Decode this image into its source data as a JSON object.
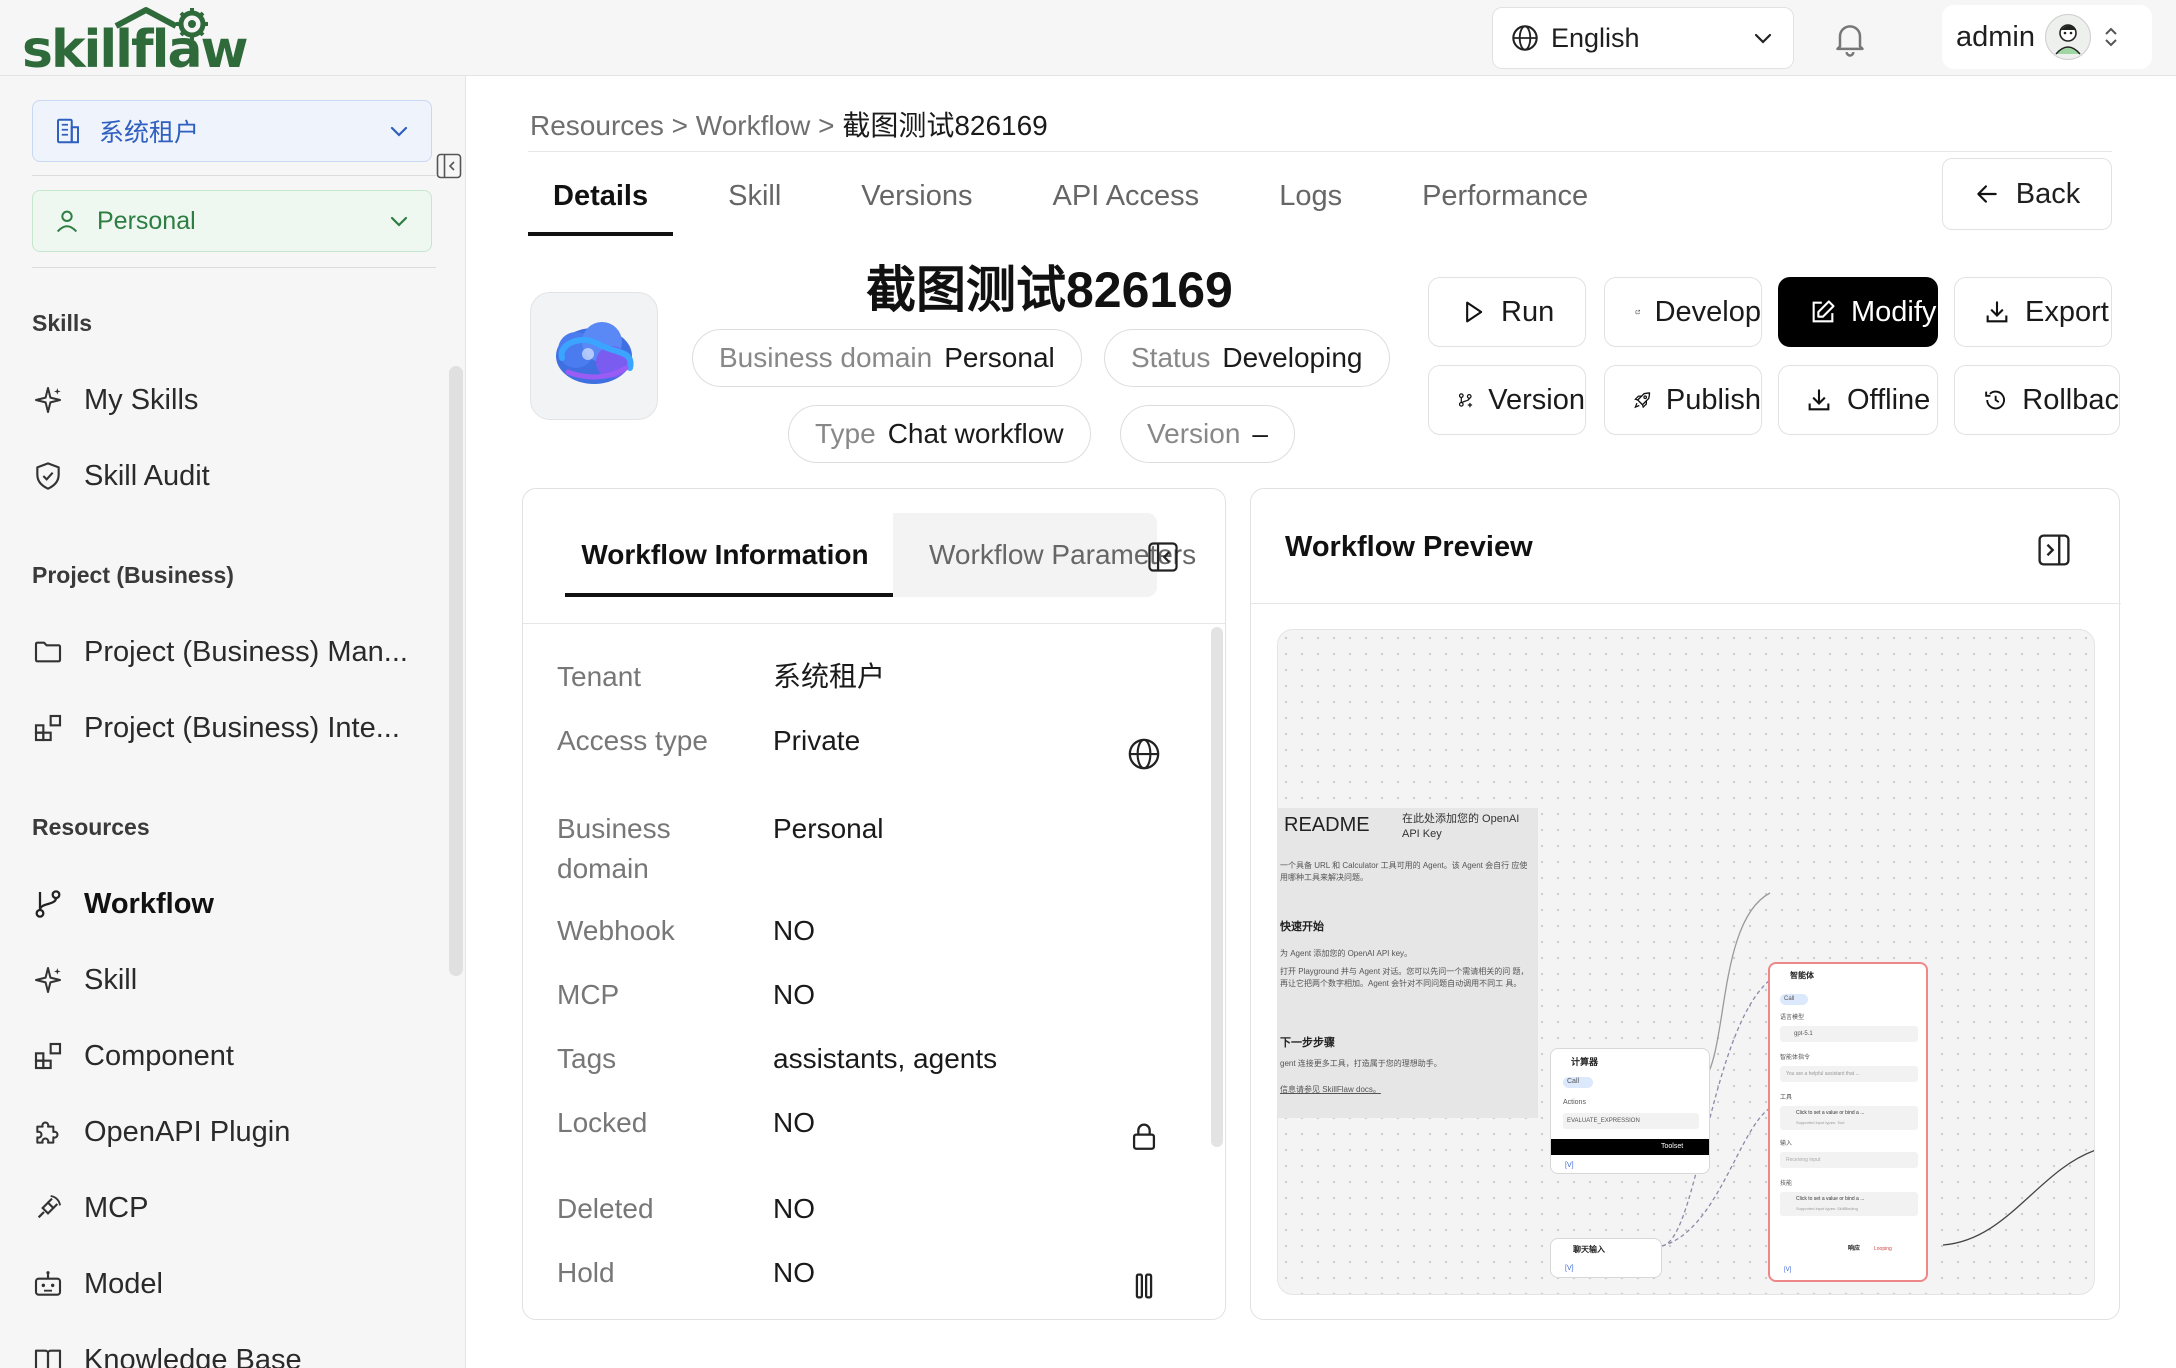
{
  "header": {
    "logo_text": "skillflaw",
    "language": "English",
    "user_name": "admin"
  },
  "sidebar": {
    "tenant_select": "系统租户",
    "scope_select": "Personal",
    "sections": {
      "skills": "Skills",
      "project": "Project (Business)",
      "resources": "Resources"
    },
    "skills_items": [
      "My Skills",
      "Skill Audit"
    ],
    "project_items": [
      "Project (Business) Man...",
      "Project (Business) Inte..."
    ],
    "resource_items": [
      "Workflow",
      "Skill",
      "Component",
      "OpenAPI Plugin",
      "MCP",
      "Model",
      "Knowledge Base"
    ]
  },
  "breadcrumb": {
    "root": "Resources",
    "sep": ">",
    "parent": "Workflow",
    "current": "截图测试826169"
  },
  "tabs": [
    "Details",
    "Skill",
    "Versions",
    "API Access",
    "Logs",
    "Performance"
  ],
  "back_label": "Back",
  "workflow": {
    "title": "截图测试826169",
    "business_domain_label": "Business domain",
    "business_domain": "Personal",
    "status_label": "Status",
    "status": "Developing",
    "type_label": "Type",
    "type": "Chat workflow",
    "version_label": "Version",
    "version": "–"
  },
  "actions": {
    "run": "Run",
    "develop": "Develop",
    "modify": "Modify",
    "export": "Export",
    "version": "Version",
    "publish": "Publish",
    "offline": "Offline",
    "rollback": "Rollbac"
  },
  "info_panel": {
    "tab_active": "Workflow Information",
    "tab_other": "Workflow Parameters",
    "rows": [
      {
        "label": "Tenant",
        "value": "系统租户"
      },
      {
        "label": "Access type",
        "value": "Private"
      },
      {
        "label": "Business domain",
        "value": "Personal"
      },
      {
        "label": "Webhook",
        "value": "NO"
      },
      {
        "label": "MCP",
        "value": "NO"
      },
      {
        "label": "Tags",
        "value": "assistants, agents"
      },
      {
        "label": "Locked",
        "value": "NO"
      },
      {
        "label": "Deleted",
        "value": "NO"
      },
      {
        "label": "Hold",
        "value": "NO"
      }
    ]
  },
  "preview": {
    "title": "Workflow Preview",
    "readme": {
      "title": "README",
      "key_note": "在此处添加您的 OpenAI API Key",
      "intro": "一个具备 URL 和 Calculator 工具可用的 Agent。该 Agent 会自行 应使用哪种工具来解决问题。",
      "start_title": "快速开始",
      "start_body_1": "为 Agent 添加您的 OpenAI API key。",
      "start_body_2": "打开 Playground 并与 Agent 对话。您可以先问一个需请相关的问 题，再让它把两个数字相加。Agent 会针对不同问题自动调用不同工 具。",
      "next_title": "下一步步骤",
      "next_body": "gent 连接更多工具，打造属于您的理想助手。",
      "more": "信息请参见 SkillFlaw docs。"
    },
    "calc_node": {
      "title": "计算器",
      "chip": "Call",
      "actions_label": "Actions",
      "field": "EVALUATE_EXPRESSION",
      "bar": "Toolset",
      "port": "[V]"
    },
    "chat_node": {
      "title": "聊天输入",
      "port": "[V]"
    },
    "agent_node": {
      "title": "智能体",
      "chip": "Call",
      "model_label": "语言模型",
      "model_value": "gpt-5.1",
      "instr_label": "智能体指令",
      "instr_value": "You are a helpful assistant that ...",
      "tools_label": "工具",
      "tools_value": "Click to set a value or bind a ...",
      "tools_hint": "Supported input types: Tool",
      "input_label": "输入",
      "input_value": "Receiving input",
      "skill_label": "技能",
      "skill_value": "Click to set a value or bind a ...",
      "skill_hint": "Supported input types: SkillBinding",
      "resp_label": "响应",
      "resp_tag": "Looping",
      "port": "[V]"
    }
  }
}
